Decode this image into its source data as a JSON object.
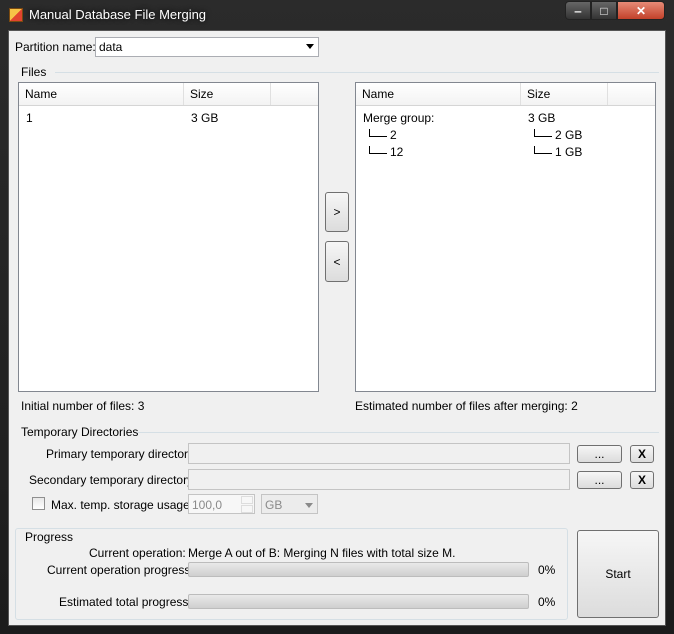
{
  "window": {
    "title": "Manual Database File Merging",
    "min_glyph": "‒",
    "max_glyph": "□",
    "close_glyph": "✕"
  },
  "partition": {
    "label": "Partition name:",
    "value": "data"
  },
  "files": {
    "group_label": "Files",
    "columns": [
      "Name",
      "Size"
    ],
    "left_rows": [
      {
        "name": "1",
        "size": "3 GB"
      }
    ],
    "right_group": {
      "name": "Merge group:",
      "size": "3 GB"
    },
    "right_children": [
      {
        "name": "2",
        "size": "2 GB"
      },
      {
        "name": "12",
        "size": "1 GB"
      }
    ],
    "move_right_label": ">",
    "move_left_label": "<",
    "initial_count_text": "Initial number of files: 3",
    "estimated_count_text": "Estimated number of files after merging: 2"
  },
  "temp": {
    "group_label": "Temporary Directories",
    "primary_label": "Primary temporary directory:",
    "secondary_label": "Secondary temporary directory:",
    "browse_label": "...",
    "clear_label": "X",
    "max_storage_label": "Max. temp. storage usage:",
    "max_storage_value": "100,0",
    "max_storage_unit": "GB",
    "max_storage_checked": false
  },
  "progress": {
    "group_label": "Progress",
    "current_op_label": "Current operation:",
    "current_op_value": "Merge A out of B: Merging N files with total size M.",
    "current_progress_label": "Current operation progress:",
    "current_progress_value": 0,
    "current_progress_text": "0%",
    "total_progress_label": "Estimated total progress:",
    "total_progress_value": 0,
    "total_progress_text": "0%"
  },
  "start_label": "Start"
}
